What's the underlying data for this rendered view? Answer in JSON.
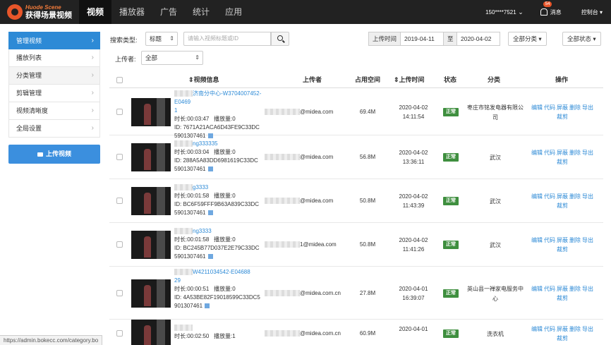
{
  "brand": {
    "name_en": "Huode Scene",
    "name_cn": "获得场景视频"
  },
  "nav": [
    "视频",
    "播放器",
    "广告",
    "统计",
    "应用"
  ],
  "top_right": {
    "user": "150****7521",
    "badge": "54",
    "messages": "消息",
    "console": "控制台"
  },
  "sidebar": {
    "items": [
      "管理视频",
      "播放列表",
      "分类管理",
      "剪辑管理",
      "视频清晰度",
      "全局设置"
    ],
    "upload": "上传视频"
  },
  "filters": {
    "search_type_label": "搜索类型:",
    "search_type_value": "标题",
    "search_placeholder": "请输入视频标题或ID",
    "upload_time_label": "上传时间",
    "date_from": "2019-04-11",
    "to": "至",
    "date_to": "2020-04-02",
    "all_categories": "全部分类",
    "all_status": "全部状态",
    "uploader_label": "上传者:",
    "uploader_value": "全部"
  },
  "table": {
    "headers": [
      "视频信息",
      "上传者",
      "占用空间",
      "上传时间",
      "状态",
      "分类",
      "操作"
    ],
    "ops": [
      "编辑",
      "代码",
      "屏蔽",
      "删除",
      "导出",
      "裁剪"
    ],
    "rows": [
      {
        "title": "济南分中心-W3704007452-E0469",
        "title2": "1",
        "duration": "时长:00:03:47",
        "plays": "播放量:0",
        "id": "ID: 7671A21ACA6D43FE9C33DC",
        "id2": "5901307461",
        "uploader": "@midea.com",
        "size": "69.4M",
        "date": "2020-04-02",
        "clock": "14:11:54",
        "status": "正常",
        "category": "枣庄市铭发电器有限公司"
      },
      {
        "title": "ng333335",
        "title2": "",
        "duration": "时长:00:03:04",
        "plays": "播放量:0",
        "id": "ID: 288A5A83DD6981619C33DC",
        "id2": "5901307461",
        "uploader": "@midea.com",
        "size": "56.8M",
        "date": "2020-04-02",
        "clock": "13:36:11",
        "status": "正常",
        "category": "武汉"
      },
      {
        "title": "g3333",
        "title2": "",
        "duration": "时长:00:01:58",
        "plays": "播放量:0",
        "id": "ID: BC6F59FFF9B63A839C33DC",
        "id2": "5901307461",
        "uploader": "@midea.com",
        "size": "50.8M",
        "date": "2020-04-02",
        "clock": "11:43:39",
        "status": "正常",
        "category": "武汉"
      },
      {
        "title": "ng3333",
        "title2": "",
        "duration": "时长:00:01:58",
        "plays": "播放量:0",
        "id": "ID: BC245B77D037E2E79C33DC",
        "id2": "5901307461",
        "uploader": "1@midea.com",
        "size": "50.8M",
        "date": "2020-04-02",
        "clock": "11:41:26",
        "status": "正常",
        "category": "武汉"
      },
      {
        "title": "W4211034542-E04688",
        "title2": "29",
        "duration": "时长:00:00:51",
        "plays": "播放量:0",
        "id": "ID: 4A53BE82F19018599C33DC5",
        "id2": "901307461",
        "uploader": "@midea.com.cn",
        "size": "27.8M",
        "date": "2020-04-01",
        "clock": "16:39:07",
        "status": "正常",
        "category": "英山县一禅家电服务中心"
      },
      {
        "title": "",
        "title2": "",
        "duration": "时长:00:02:50",
        "plays": "播放量:1",
        "id": "",
        "id2": "",
        "uploader": "@midea.com.cn",
        "size": "60.9M",
        "date": "2020-04-01",
        "clock": "",
        "status": "正常",
        "category": "洗衣机"
      }
    ]
  },
  "statusbar": "https://admin.bokecc.com/category.bo"
}
